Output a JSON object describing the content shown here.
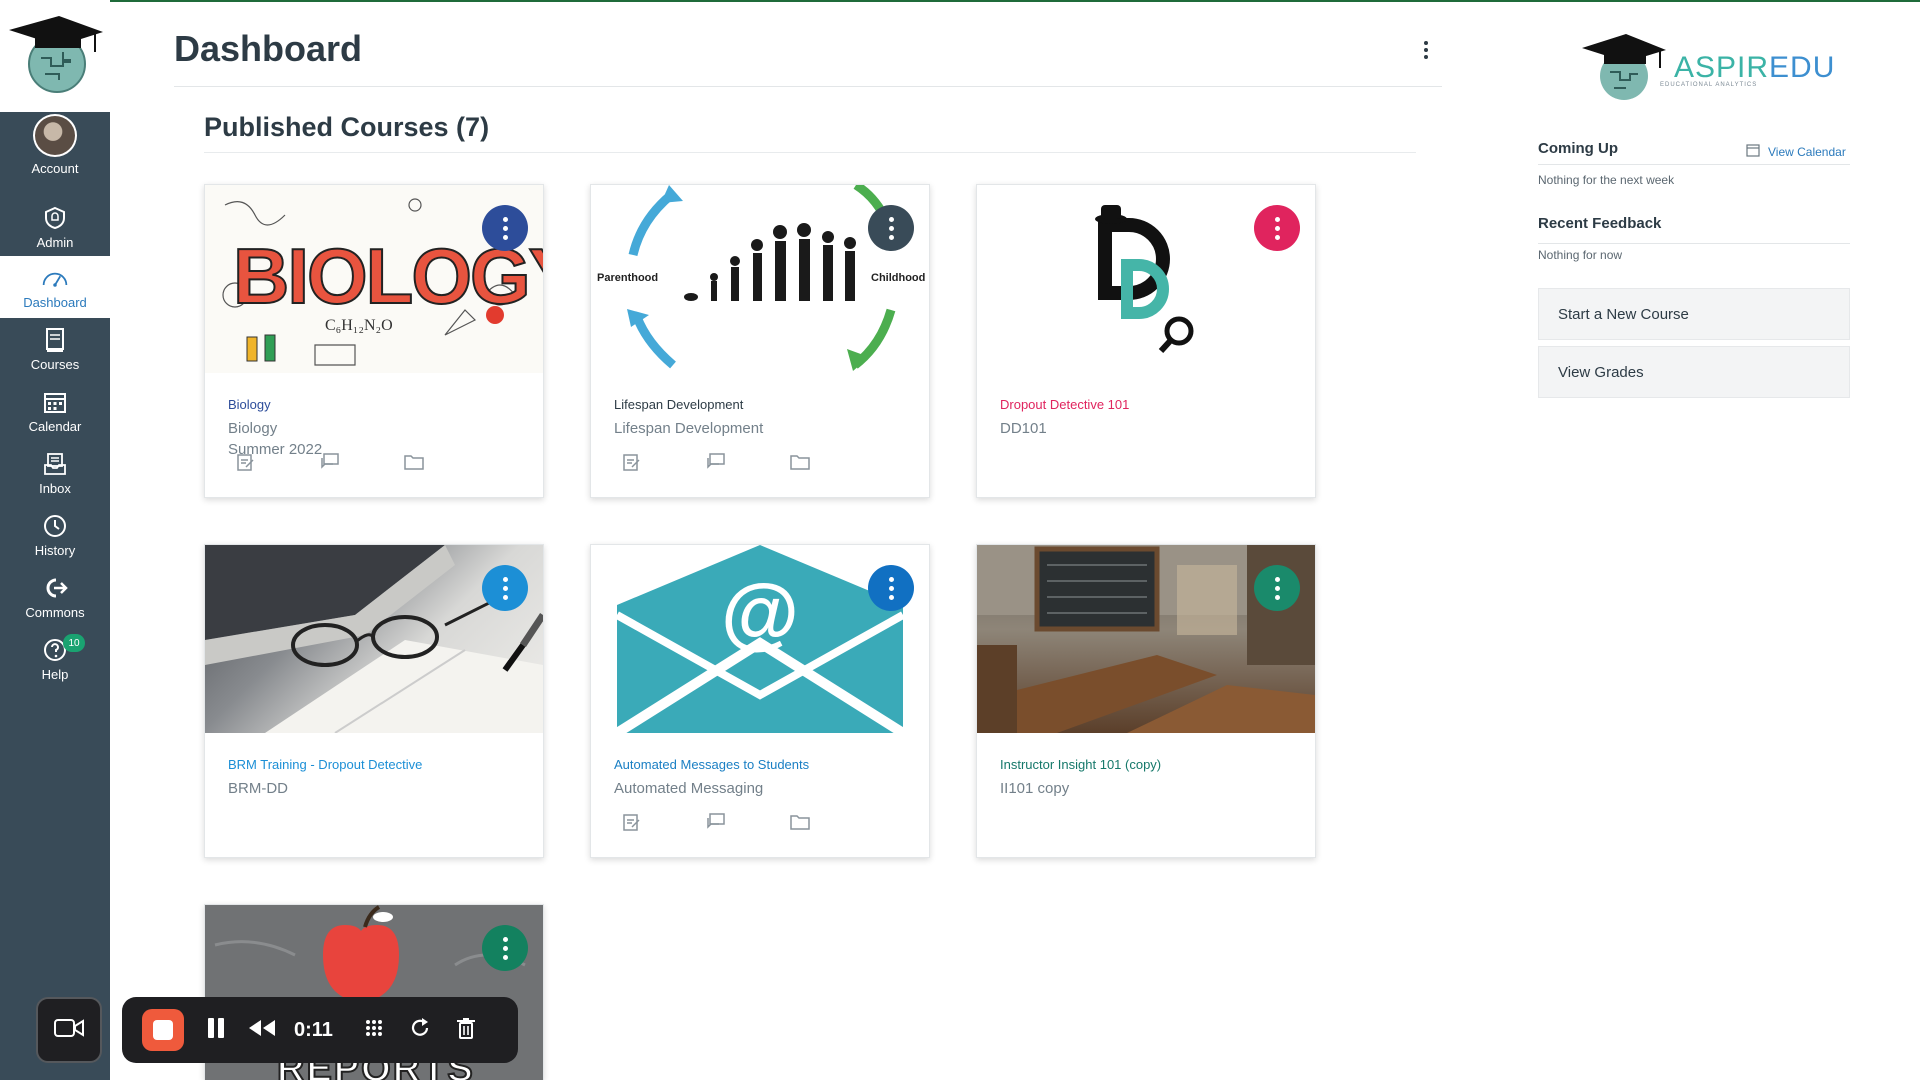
{
  "page": {
    "title": "Dashboard",
    "section_title": "Published Courses (7)"
  },
  "nav": {
    "items": [
      {
        "label": "Account",
        "icon": "avatar"
      },
      {
        "label": "Admin",
        "icon": "shield-icon"
      },
      {
        "label": "Dashboard",
        "icon": "dashboard-gauge-icon"
      },
      {
        "label": "Courses",
        "icon": "book-icon"
      },
      {
        "label": "Calendar",
        "icon": "calendar-icon"
      },
      {
        "label": "Inbox",
        "icon": "inbox-icon"
      },
      {
        "label": "History",
        "icon": "clock-icon"
      },
      {
        "label": "Commons",
        "icon": "commons-icon"
      },
      {
        "label": "Help",
        "icon": "help-icon",
        "badge": "10"
      }
    ],
    "active": "Dashboard"
  },
  "cards": [
    {
      "name": "Biology",
      "code": "Biology",
      "term": "Summer 2022",
      "color": "#2d4d9a",
      "name_color": "#2d4d9a",
      "hero_text": "BIOLOGY"
    },
    {
      "name": "Lifespan Development",
      "code": "Lifespan Development",
      "term": "",
      "color": "#394b58",
      "name_color": "#2d3b45",
      "hero_left": "Parenthood",
      "hero_right": "Childhood"
    },
    {
      "name": "Dropout Detective 101",
      "code": "DD101",
      "term": "",
      "color": "#e0245e",
      "name_color": "#e0245e"
    },
    {
      "name": "BRM Training - Dropout Detective",
      "code": "BRM-DD",
      "term": "",
      "color": "#1c8fd6",
      "name_color": "#1c8fd6"
    },
    {
      "name": "Automated Messages to Students",
      "code": "Automated Messaging",
      "term": "",
      "color": "#1170c2",
      "name_color": "#1a7fc4"
    },
    {
      "name": "Instructor Insight 101 (copy)",
      "code": "II101 copy",
      "term": "",
      "color": "#1a8a6b",
      "name_color": "#15786a"
    },
    {
      "name": "",
      "code": "",
      "term": "",
      "color": "#13815f",
      "name_color": "#13815f",
      "hero_text": "REPORTS"
    }
  ],
  "sidebar": {
    "brand_a": "ASPIR",
    "brand_b": "EDU",
    "brand_sub": "EDUCATIONAL ANALYTICS",
    "coming_up": "Coming Up",
    "view_calendar": "View Calendar",
    "coming_up_note": "Nothing for the next week",
    "recent_feedback": "Recent Feedback",
    "recent_feedback_note": "Nothing for now",
    "start_course": "Start a New Course",
    "view_grades": "View Grades"
  },
  "recorder": {
    "time": "0:11"
  }
}
